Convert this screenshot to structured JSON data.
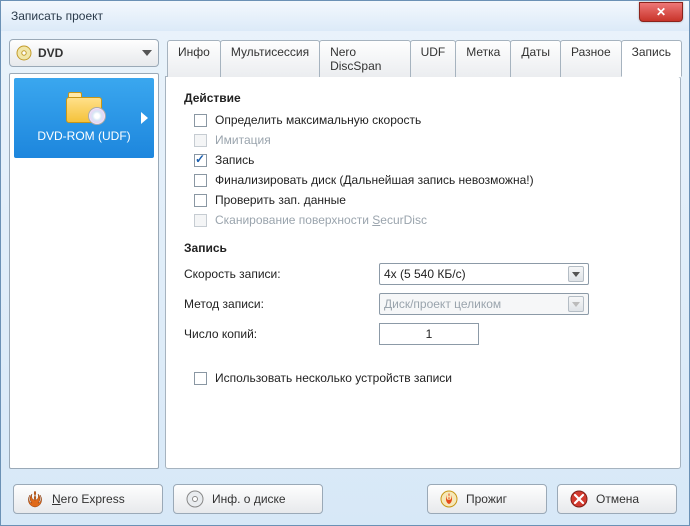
{
  "window": {
    "title": "Записать проект"
  },
  "drive": {
    "label": "DVD"
  },
  "projects": [
    {
      "name": "DVD-ROM (UDF)"
    }
  ],
  "tabs": {
    "items": [
      {
        "label": "Инфо"
      },
      {
        "label": "Мультисессия"
      },
      {
        "label": "Nero DiscSpan"
      },
      {
        "label": "UDF"
      },
      {
        "label": "Метка"
      },
      {
        "label": "Даты"
      },
      {
        "label": "Разное"
      },
      {
        "label": "Запись"
      }
    ],
    "active_index": 7
  },
  "panel": {
    "action_title": "Действие",
    "opt_max_speed": "Определить максимальную скорость",
    "opt_simulation": "Имитация",
    "opt_write": "Запись",
    "opt_finalize": "Финализировать диск (Дальнейшая запись невозможна!)",
    "opt_verify": "Проверить зап. данные",
    "opt_securdisc_prefix": "Сканирование поверхности ",
    "opt_securdisc_suffix": "ecurDisc",
    "write_title": "Запись",
    "lbl_speed": "Скорость записи:",
    "val_speed": "4x (5 540 КБ/с)",
    "lbl_method": "Метод записи:",
    "val_method": "Диск/проект целиком",
    "lbl_copies": "Число копий:",
    "val_copies": "1",
    "opt_multiple_devices": "Использовать несколько устройств записи"
  },
  "footer": {
    "nero_suffix": "ero Express",
    "disc_prefix": "Инф. о ",
    "disc_suffix": "иске",
    "burn": "Прожиг",
    "cancel": "Отмена"
  }
}
